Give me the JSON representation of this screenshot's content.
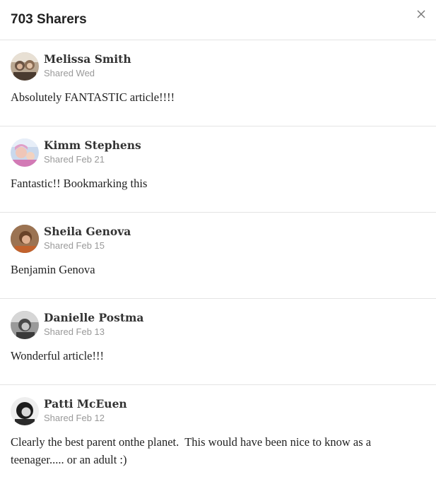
{
  "header": {
    "title": "703 Sharers",
    "close_icon": "close-icon"
  },
  "sharers": [
    {
      "name": "Melissa Smith",
      "date": "Shared Wed",
      "comment": "Absolutely FANTASTIC article!!!!"
    },
    {
      "name": "Kimm Stephens",
      "date": "Shared Feb 21",
      "comment": "Fantastic!! Bookmarking this"
    },
    {
      "name": "Sheila Genova",
      "date": "Shared Feb 15",
      "comment": "Benjamin Genova"
    },
    {
      "name": "Danielle Postma",
      "date": "Shared Feb 13",
      "comment": "Wonderful article!!!"
    },
    {
      "name": "Patti McEuen",
      "date": "Shared Feb 12",
      "comment": "Clearly the best parent onthe planet.  This would have been nice to know as a teenager..... or an adult :)"
    }
  ]
}
